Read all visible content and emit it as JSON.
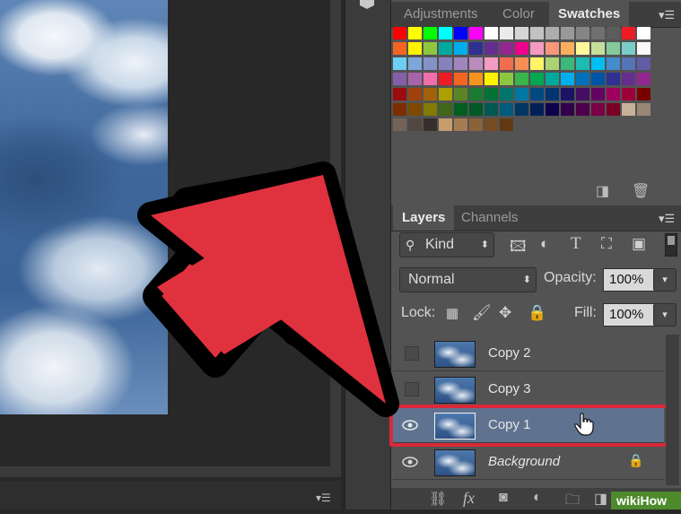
{
  "adjust_panel": {
    "tabs": [
      "Adjustments",
      "Color",
      "Swatches"
    ],
    "active_tab": "Swatches",
    "swatch_rows": [
      [
        "#ff0000",
        "#ffff00",
        "#00ff00",
        "#00ffff",
        "#0000ff",
        "#ff00ff",
        "#ffffff",
        "#ebebeb",
        "#d6d6d6",
        "#c2c2c2",
        "#adadad",
        "#999999",
        "#858585",
        "#707070",
        "#5c5c5c",
        "#ed1c24",
        "#ffffff"
      ],
      [
        "#f26522",
        "#fff200",
        "#8dc63f",
        "#00a99d",
        "#00aeef",
        "#2e3192",
        "#662d91",
        "#92278f",
        "#ec008c",
        "#f49ac1",
        "#f7977a",
        "#fbaf5d",
        "#fff799",
        "#c4df9b",
        "#82ca9c",
        "#7bcdc8",
        "#f8f8f8"
      ],
      [
        "#6dcff6",
        "#7da7d9",
        "#8393ca",
        "#8781bd",
        "#a186be",
        "#bd8cbf",
        "#f49bc1",
        "#f26c4f",
        "#f68e56",
        "#fff468",
        "#acd373",
        "#3cb878",
        "#1cbbb4",
        "#00bff3",
        "#448ccb",
        "#5574b9",
        "#605ca8"
      ],
      [
        "#855fa8",
        "#a864a8",
        "#f06ea9",
        "#ed1c24",
        "#f26522",
        "#f7941d",
        "#fff200",
        "#8dc63f",
        "#39b54a",
        "#00a651",
        "#00a99d",
        "#00aeef",
        "#0072bc",
        "#0054a6",
        "#2e3192",
        "#662d91",
        "#92278f"
      ],
      [
        "#9e0b0f",
        "#a0410d",
        "#a36209",
        "#aba000",
        "#598527",
        "#197b30",
        "#007236",
        "#00746b",
        "#0076a3",
        "#004a80",
        "#003471",
        "#1b1464",
        "#440e62",
        "#630460",
        "#9e005d",
        "#9e0039",
        "#790000"
      ],
      [
        "#7b2e00",
        "#7d4900",
        "#827b00",
        "#406618",
        "#005e20",
        "#005826",
        "#005952",
        "#005b7f",
        "#003663",
        "#002157",
        "#0d004c",
        "#32004b",
        "#4b0049",
        "#7b0046",
        "#7a0026",
        "#c7b299",
        "#998675"
      ],
      [
        "#736357",
        "#534741",
        "#362f2d",
        "#c69c6d",
        "#a67c52",
        "#8c6239",
        "#754c24",
        "#603913"
      ]
    ],
    "menu_icon": "panel-menu-icon"
  },
  "swatch_footer": {
    "new_icon": "new-swatch-icon",
    "delete_icon": "trash-icon"
  },
  "layers_panel": {
    "tabs": [
      "Layers",
      "Channels"
    ],
    "active_tab": "Layers",
    "filter_kind": "Kind",
    "blend_mode": "Normal",
    "opacity_label": "Opacity:",
    "opacity_value": "100%",
    "lock_label": "Lock:",
    "fill_label": "Fill:",
    "fill_value": "100%",
    "layers": [
      {
        "name": "Copy 2",
        "visible": false,
        "selected": false,
        "italic": false,
        "locked": false
      },
      {
        "name": "Copy 3",
        "visible": false,
        "selected": false,
        "italic": false,
        "locked": false
      },
      {
        "name": "Copy 1",
        "visible": true,
        "selected": true,
        "italic": false,
        "locked": false
      },
      {
        "name": "Background",
        "visible": true,
        "selected": false,
        "italic": true,
        "locked": true
      }
    ],
    "footer_icons": [
      "link-icon",
      "fx-icon",
      "mask-icon",
      "adjustment-icon",
      "folder-icon",
      "new-layer-icon"
    ],
    "fx_label": "fx"
  },
  "watermark": {
    "text": "wikiHow"
  },
  "accent": {
    "arrow_fill": "#e0313f",
    "highlight_border": "#d9293a",
    "selected_row": "#5f7390"
  }
}
